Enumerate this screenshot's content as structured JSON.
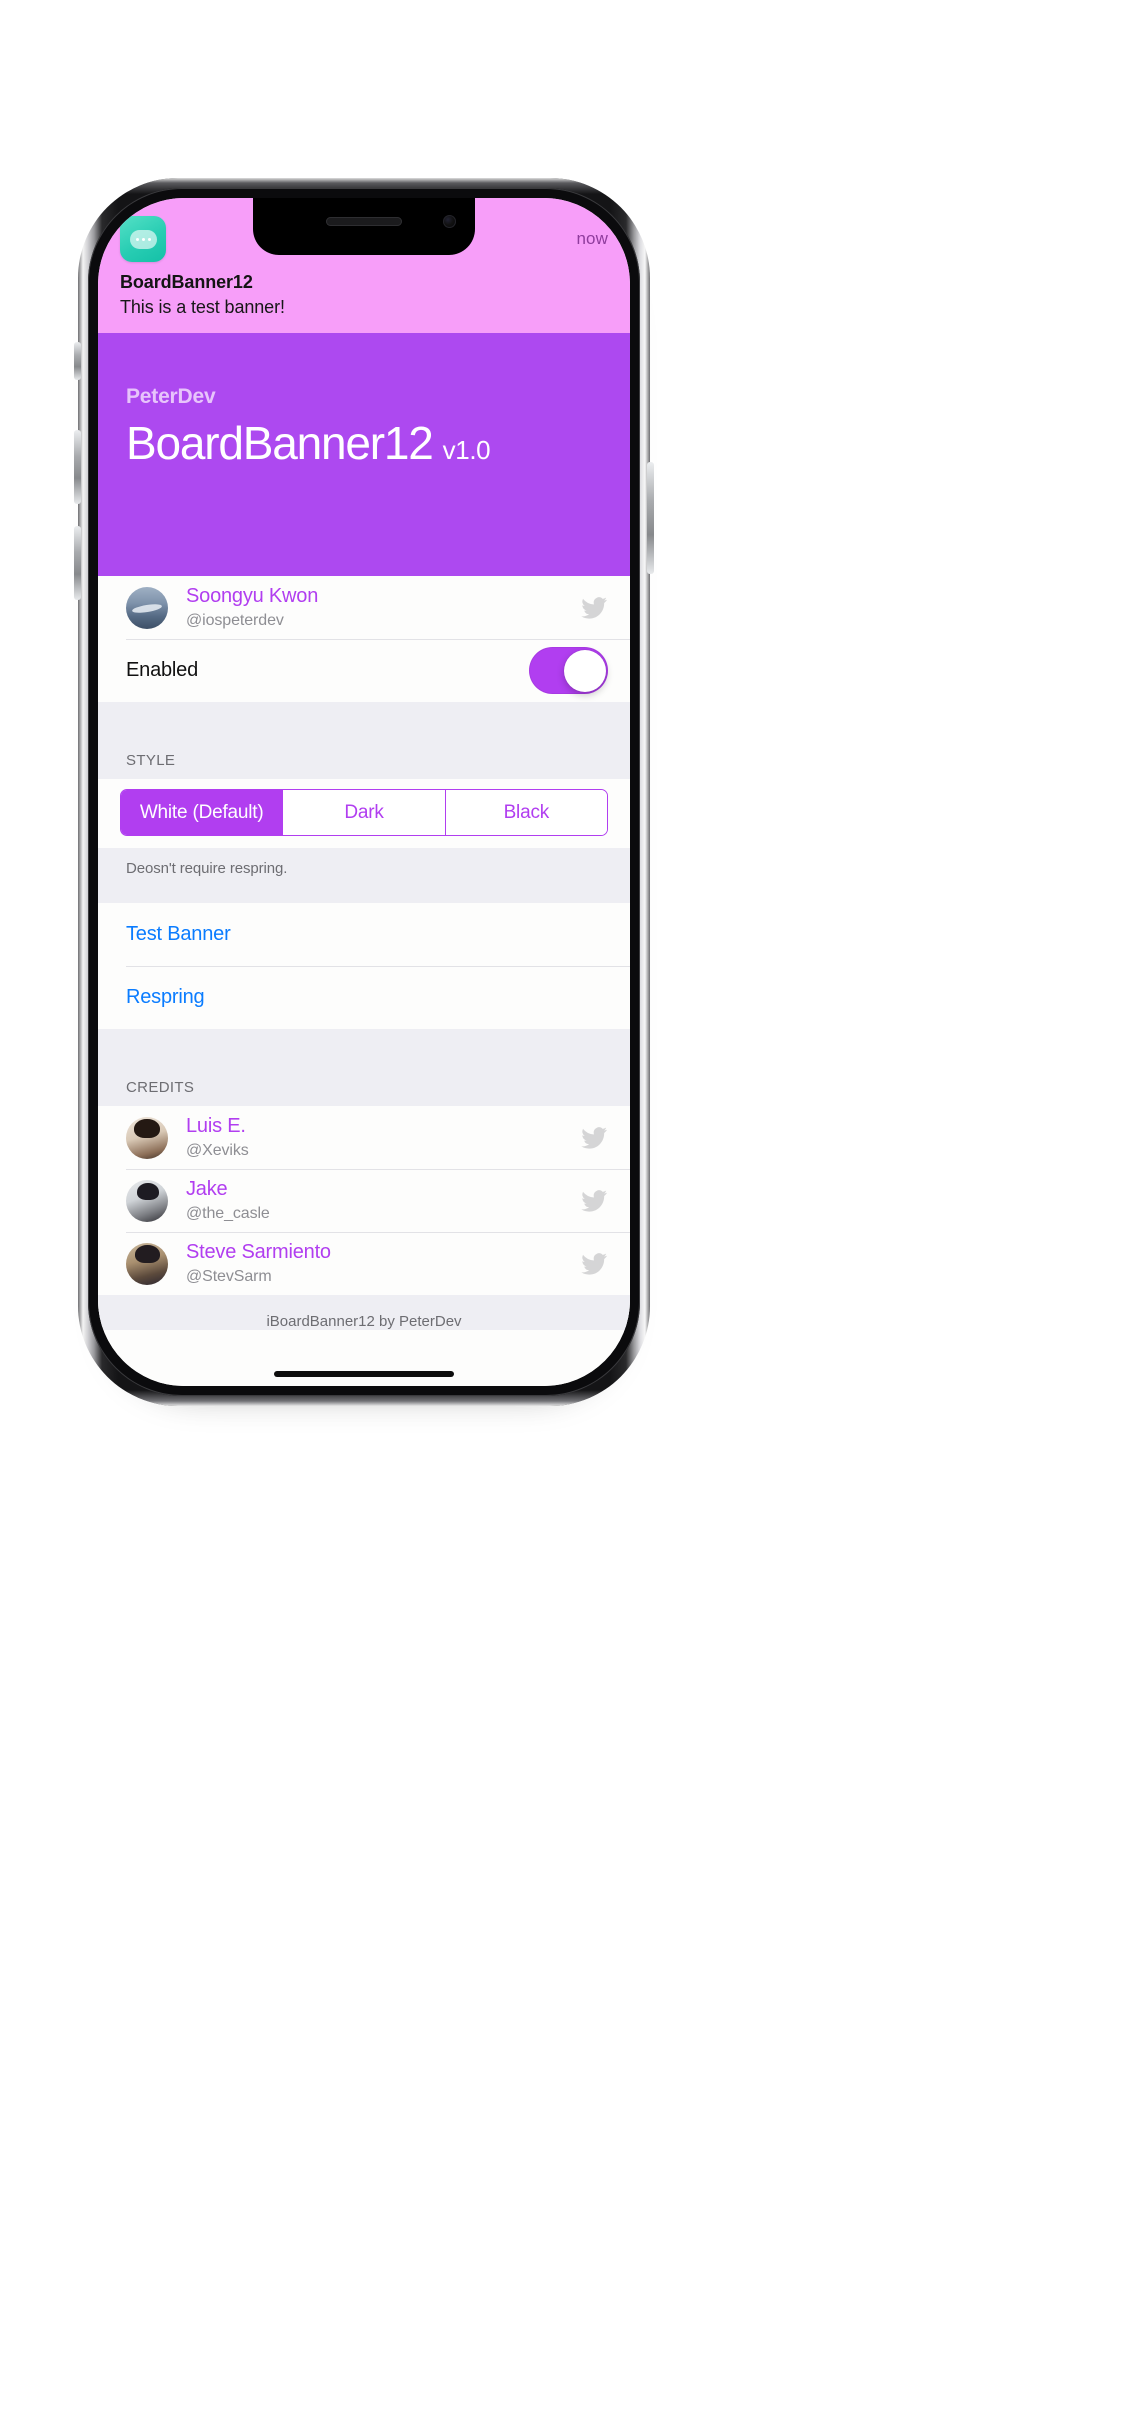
{
  "banner": {
    "app_icon": "chat-bubble-icon",
    "time": "now",
    "title": "BoardBanner12",
    "message": "This is a test banner!",
    "background_color": "#f79ef9"
  },
  "hero": {
    "developer": "PeterDev",
    "title": "BoardBanner12",
    "version": "v1.0",
    "background_color": "#ad49f0"
  },
  "author": {
    "name": "Soongyu Kwon",
    "handle": "@iospeterdev",
    "twitter_icon": "twitter-bird-icon"
  },
  "enabled_row": {
    "label": "Enabled",
    "switch_on": true,
    "accent_color": "#b13ef0"
  },
  "style_section": {
    "header": "STYLE",
    "options": [
      {
        "label": "White (Default)",
        "selected": true
      },
      {
        "label": "Dark",
        "selected": false
      },
      {
        "label": "Black",
        "selected": false
      }
    ],
    "footer": "Deosn't require respring."
  },
  "actions": [
    {
      "label": "Test Banner"
    },
    {
      "label": "Respring"
    }
  ],
  "credits_section": {
    "header": "CREDITS",
    "people": [
      {
        "name": "Luis E.",
        "handle": "@Xeviks",
        "twitter_icon": "twitter-bird-icon"
      },
      {
        "name": "Jake",
        "handle": "@the_casle",
        "twitter_icon": "twitter-bird-icon"
      },
      {
        "name": "Steve Sarmiento",
        "handle": "@StevSarm",
        "twitter_icon": "twitter-bird-icon"
      }
    ]
  },
  "bottom_footer": "iBoardBanner12 by PeterDev",
  "colors": {
    "accent_purple": "#b13ef0",
    "hero_purple": "#ad49f0",
    "banner_pink": "#f79ef9",
    "link_blue": "#0a7cff",
    "group_bg": "#eeeef3"
  }
}
